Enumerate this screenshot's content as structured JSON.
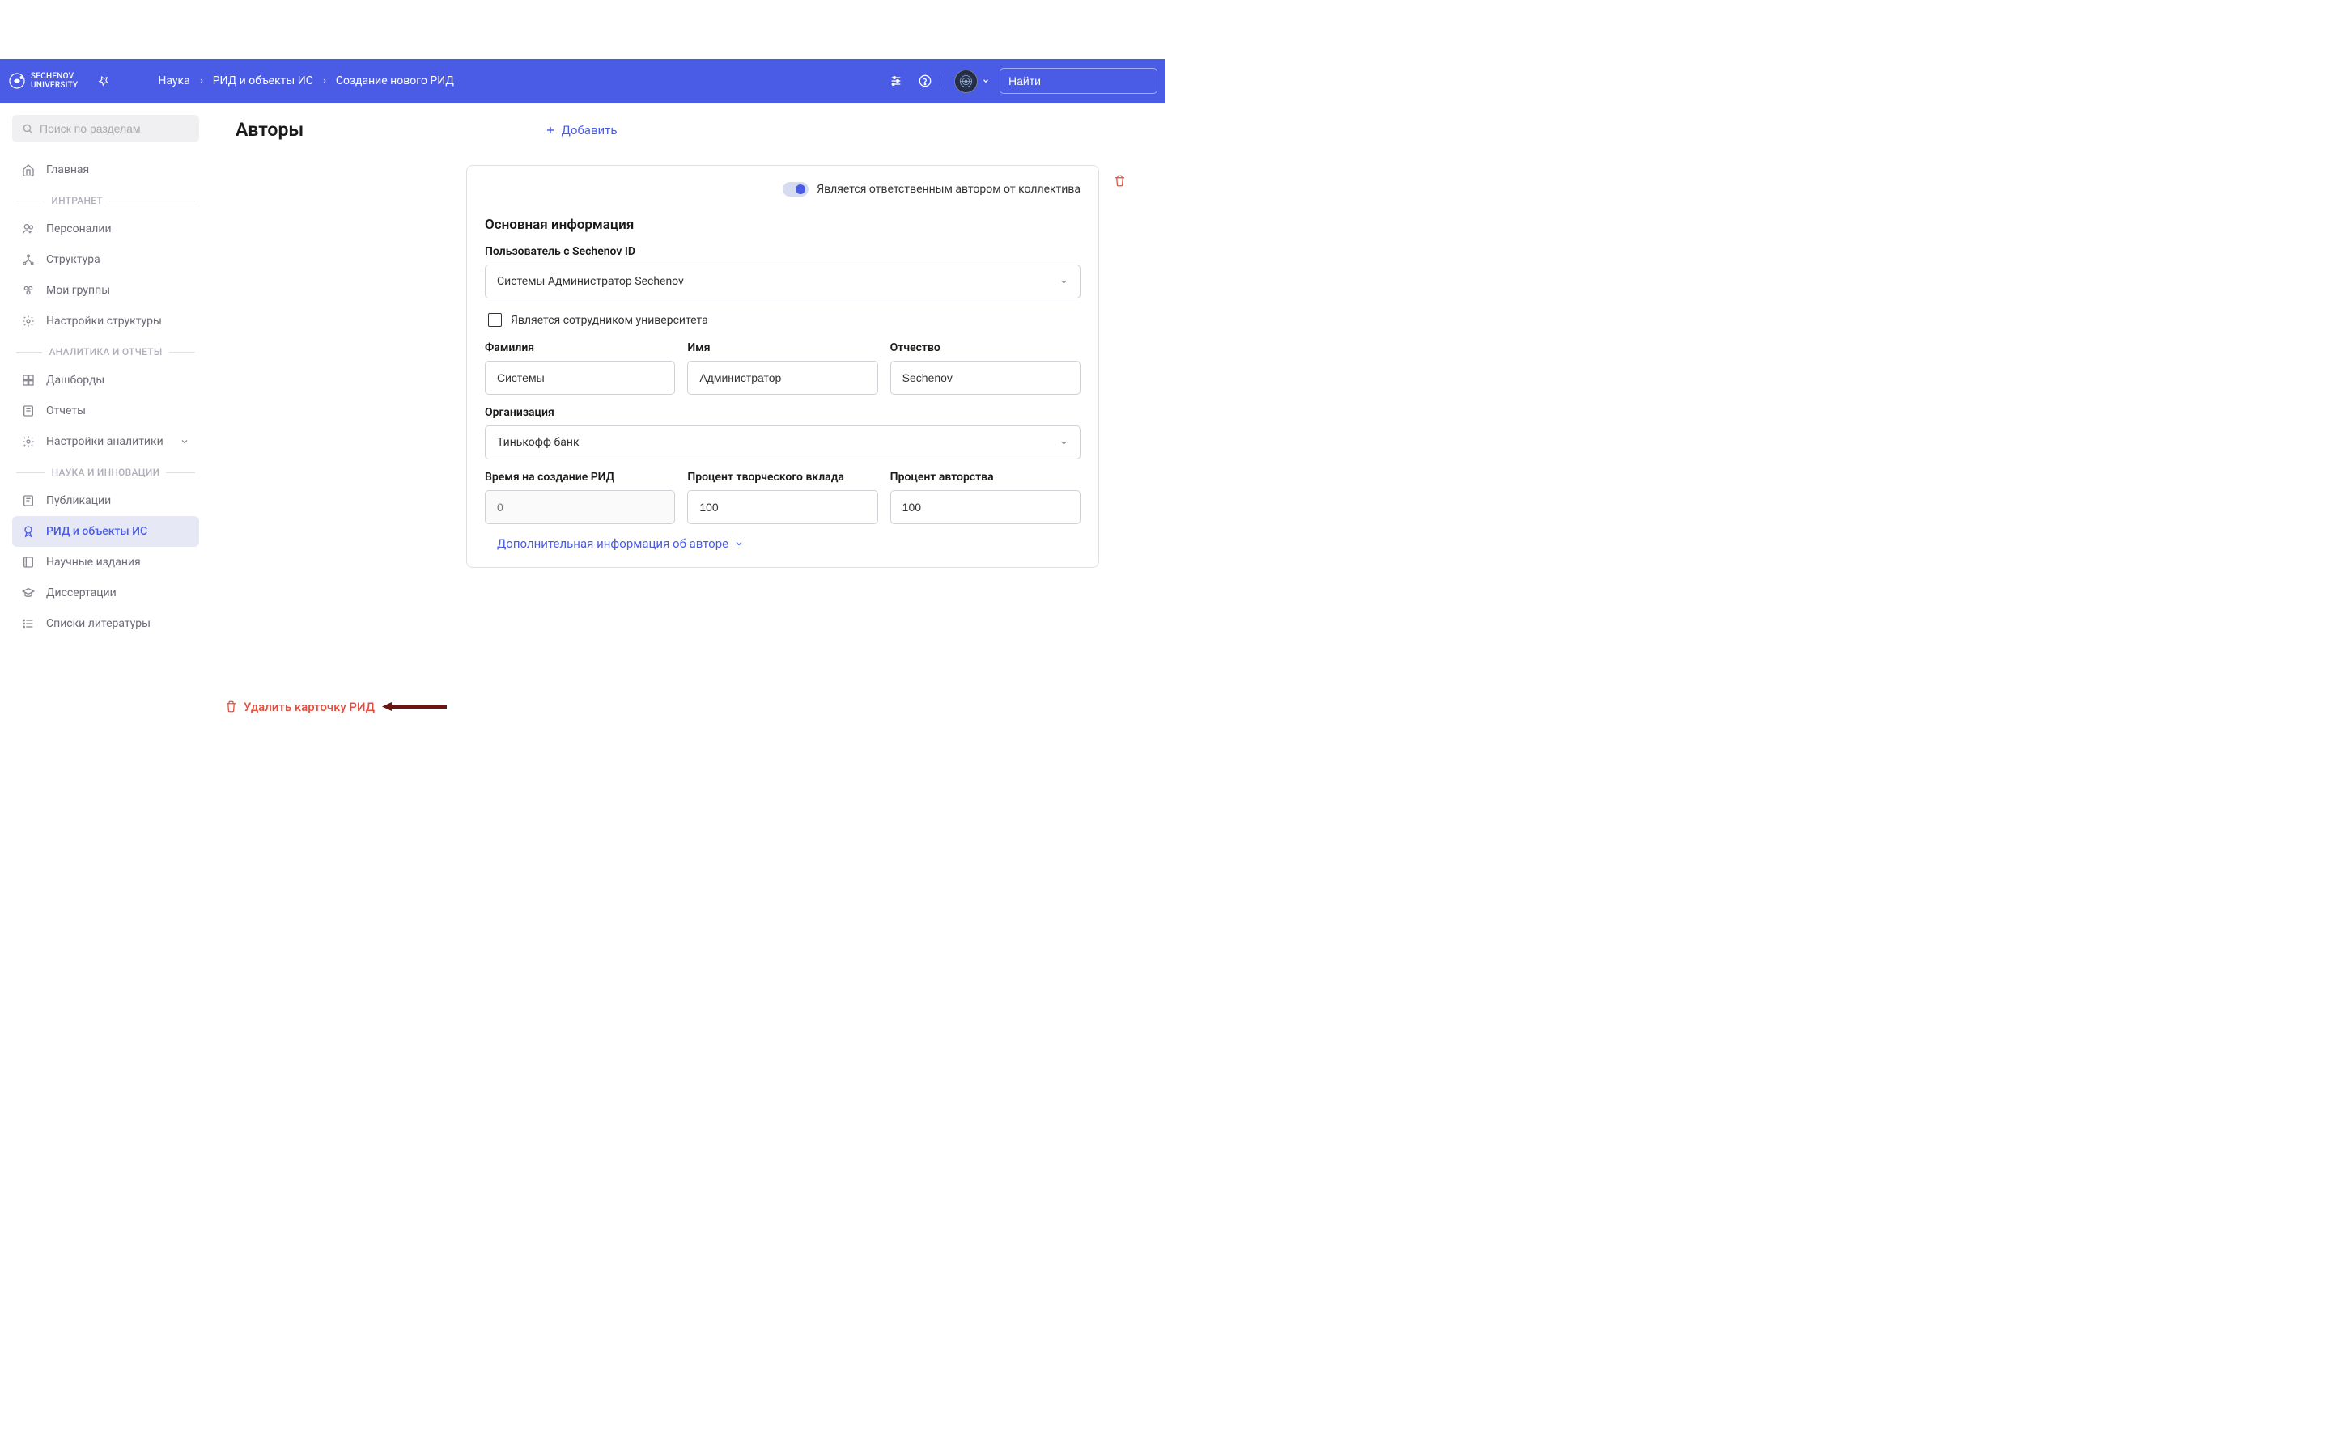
{
  "header": {
    "logo_text": "SECHENOV\nUNIVERSITY",
    "breadcrumbs": [
      "Наука",
      "РИД и объекты ИС",
      "Создание нового РИД"
    ],
    "search_placeholder": "Найти"
  },
  "sidebar": {
    "search_placeholder": "Поиск по разделам",
    "items": [
      {
        "label": "Главная",
        "icon": "home"
      }
    ],
    "sections": [
      {
        "title": "ИНТРАНЕТ",
        "items": [
          {
            "label": "Персоналии",
            "icon": "people"
          },
          {
            "label": "Структура",
            "icon": "structure"
          },
          {
            "label": "Мои группы",
            "icon": "groups"
          },
          {
            "label": "Настройки структуры",
            "icon": "gear"
          }
        ]
      },
      {
        "title": "АНАЛИТИКА И ОТЧЕТЫ",
        "items": [
          {
            "label": "Дашборды",
            "icon": "dashboard"
          },
          {
            "label": "Отчеты",
            "icon": "reports"
          },
          {
            "label": "Настройки аналитики",
            "icon": "gear",
            "expandable": true
          }
        ]
      },
      {
        "title": "НАУКА И ИННОВАЦИИ",
        "items": [
          {
            "label": "Публикации",
            "icon": "publications"
          },
          {
            "label": "РИД и объекты ИС",
            "icon": "award",
            "active": true
          },
          {
            "label": "Научные издания",
            "icon": "journal"
          },
          {
            "label": "Диссертации",
            "icon": "graduation"
          },
          {
            "label": "Списки литературы",
            "icon": "list"
          }
        ]
      }
    ]
  },
  "main": {
    "title": "Авторы",
    "add_button": "Добавить",
    "toggle_label": "Является ответственным автором от коллектива",
    "section_title": "Основная информация",
    "user_label": "Пользователь с Sechenov ID",
    "user_value": "Системы Администратор Sechenov",
    "checkbox_label": "Является сотрудником университета",
    "lastname_label": "Фамилия",
    "lastname_value": "Системы",
    "firstname_label": "Имя",
    "firstname_value": "Администратор",
    "patronymic_label": "Отчество",
    "patronymic_value": "Sechenov",
    "org_label": "Организация",
    "org_value": "Тинькофф банк",
    "time_label": "Время на создание РИД",
    "time_placeholder": "0",
    "contrib_label": "Процент творческого вклада",
    "contrib_value": "100",
    "authorship_label": "Процент авторства",
    "authorship_value": "100",
    "expand_label": "Дополнительная информация об авторе",
    "delete_card": "Удалить карточку РИД"
  }
}
